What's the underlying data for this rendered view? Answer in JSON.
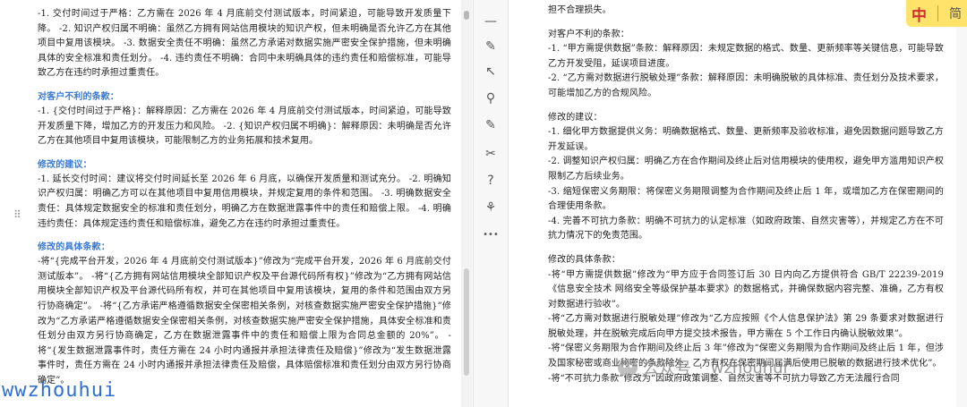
{
  "left_doc": {
    "intro_lines": [
      "-1. 交付时间过于严格：乙方需在 2026 年 4 月底前交付测试版本，时间紧迫，可能导致开发质量下降。 -2. 知识产权归属不明确：虽然乙方拥有网站信用模块的知识产权，但未明确是否允许乙方在其他项目中复用该模块。 -3. 数据安全责任不明确：虽然乙方承诺对数据实施严密安全保护措施，但未明确具体的安全标准和责任划分。 -4. 违约责任不明确：合同中未明确具体的违约责任和赔偿标准，可能导致乙方在违约时承担过重责任。"
    ],
    "section1_heading": "对客户不利的条款：",
    "section1_body": "-1. {交付时间过于严格}：解释原因：乙方需在 2026 年 4 月底前交付测试版本，时间紧迫，可能导致开发质量下降，增加乙方的开发压力和风险。 -2. {知识产权归属不明确}：解释原因：未明确是否允许乙方在其他项目中复用该模块，可能限制乙方的业务拓展和技术复用。",
    "section2_heading": "修改的建议：",
    "section2_body": "-1. 延长交付时间：建议将交付时间延长至 2026 年 6 月底，以确保开发质量和测试充分。 -2. 明确知识产权归属：明确乙方可以在其他项目中复用信用模块，并规定复用的条件和范围。 -3. 明确数据安全责任：具体规定数据安全的标准和责任划分，明确乙方在数据泄露事件中的责任和赔偿上限。 -4. 明确违约责任：具体规定违约责任和赔偿标准，避免乙方在违约时承担过重责任。",
    "section3_heading": "修改的具体条款：",
    "section3_body": "-将“{完成平台开发，2026 年 4 月底前交付测试版本}”修改为“完成平台开发，2026 年 6 月底前交付测试版本”。 -将“{乙方拥有网站信用模块全部知识产权及平台源代码所有权}”修改为“乙方拥有网站信用模块全部知识产权及平台源代码所有权，并可在其他项目中复用该模块，复用的条件和范围由双方另行协商确定”。 -将“{乙方承诺严格遵循数据安全保密相关条例，对核查数据实施严密安全保护措施}”修改为“乙方承诺严格遵循数据安全保密相关条例，对核查数据实施严密安全保护措施，具体安全标准和责任划分由双方另行协商确定，乙方在数据泄露事件中的责任和赔偿上限为合同总金额的 20%”。 -将“{发生数据泄露事件时，责任方需在 24 小时内通报并承担法律责任及赔偿}”修改为“发生数据泄露事件时，责任方需在 24 小时内通报并承担法律责任及赔偿，具体赔偿标准和责任划分由双方另行协商确定”。"
  },
  "right_doc": {
    "top_line": "担不合理损失。",
    "section1_heading": "对客户不利的条款：",
    "section1_body": [
      "-1. “甲方需提供数据”条款：解释原因：未规定数据的格式、数量、更新频率等关键信息，可能导致乙方开发受阻，延误项目进度。",
      "-2. “乙方需对数据进行脱敏处理”条款：解释原因：未明确脱敏的具体标准、责任划分及技术要求，可能增加乙方的合规风险。"
    ],
    "section2_heading": "修改的建议：",
    "section2_body": [
      "-1. 细化甲方数据提供义务：明确数据格式、数量、更新频率及验收标准，避免因数据问题导致乙方开发延误。",
      "-2. 调整知识产权归属：明确乙方在合作期间及终止后对信用模块的使用权，避免甲方滥用知识产权限制乙方后续业务。",
      "-3. 缩短保密义务期限：将保密义务期限调整为合作期间及终止后 1 年，或增加乙方在保密期间的合理使用条款。",
      "-4. 完善不可抗力条款：明确不可抗力的认定标准（如政府政策、自然灾害等），并规定乙方在不可抗力情况下的免责范围。"
    ],
    "section3_heading": "修改的具体条款：",
    "section3_body": [
      "-将“甲方需提供数据”修改为“甲方应于合同签订后 30 日内向乙方提供符合 GB/T 22239-2019《信息安全技术 网络安全等级保护基本要求》的数据格式，并确保数据内容完整、准确，乙方有权对数据进行验收”。",
      "-将“乙方需对数据进行脱敏处理”修改为“乙方应按照《个人信息保护法》第 29 条要求对数据进行脱敏处理，并在脱敏完成后向甲方提交技术报告，甲方需在 5 个工作日内确认脱敏效果”。",
      "-将“保密义务期限为合作期间及终止后 3 年”修改为“保密义务期限为合作期间及终止后 1 年，但涉及国家秘密或商业秘密的条款除外，乙方有权在保密期间届满后使用已脱敏的数据进行技术优化”。",
      "-将“不可抗力条款”修改为“因政府政策调整、自然灾害等不可抗力导致乙方无法履行合同"
    ]
  },
  "ime": {
    "zh": "中",
    "jian": "简"
  },
  "watermark_right": {
    "prefix": "公众号",
    "name": "wzhouhui"
  },
  "watermark_left": "wwzhouhui",
  "toolbar": {
    "icons": [
      "minus-icon",
      "pen-icon",
      "cursor-icon",
      "adjust-icon",
      "ai-icon",
      "tools-icon",
      "help-icon",
      "shirt-icon",
      "more-icon"
    ],
    "glyphs": [
      "—",
      "✎",
      "↖",
      "⚲",
      "✎",
      "✂",
      "?",
      "⚘",
      "•••"
    ]
  },
  "colors": {
    "heading": "#3a7bd5",
    "ime_bg": "#ffe36a",
    "watermark_left": "#2f6fd6"
  }
}
